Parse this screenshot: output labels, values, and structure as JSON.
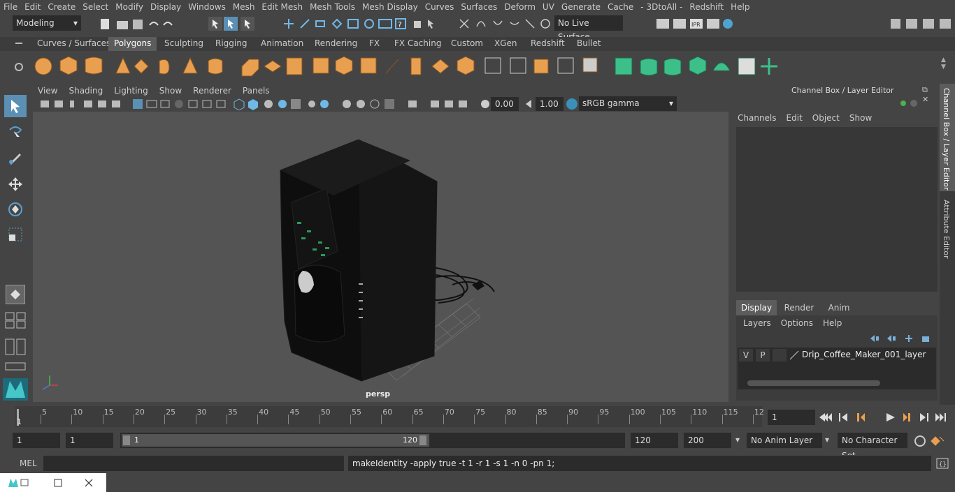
{
  "menu": [
    "File",
    "Edit",
    "Create",
    "Select",
    "Modify",
    "Display",
    "Windows",
    "Mesh",
    "Edit Mesh",
    "Mesh Tools",
    "Mesh Display",
    "Curves",
    "Surfaces",
    "Deform",
    "UV",
    "Generate",
    "Cache",
    "- 3DtoAll -",
    "Redshift",
    "Help"
  ],
  "status": {
    "workspace": "Modeling",
    "live_surface": "No Live Surface"
  },
  "shelf_tabs": [
    "Curves / Surfaces",
    "Polygons",
    "Sculpting",
    "Rigging",
    "Animation",
    "Rendering",
    "FX",
    "FX Caching",
    "Custom",
    "XGen",
    "Redshift",
    "Bullet"
  ],
  "shelf_active": "Polygons",
  "panel_menu": [
    "View",
    "Shading",
    "Lighting",
    "Show",
    "Renderer",
    "Panels"
  ],
  "panel_toolbar": {
    "exposure": "0.00",
    "gamma": "1.00",
    "color_space": "sRGB gamma"
  },
  "viewport": {
    "camera_label": "persp"
  },
  "channel_box": {
    "title": "Channel Box / Layer Editor",
    "menu": [
      "Channels",
      "Edit",
      "Object",
      "Show"
    ],
    "tabs": [
      "Display",
      "Render",
      "Anim"
    ],
    "active_tab": "Display",
    "layer_menu": [
      "Layers",
      "Options",
      "Help"
    ],
    "layer": {
      "v": "V",
      "p": "P",
      "name": "Drip_Coffee_Maker_001_layer"
    }
  },
  "side_tabs": {
    "channel": "Channel Box / Layer Editor",
    "attribute": "Attribute Editor"
  },
  "timeline": {
    "ticks": [
      "5",
      "10",
      "15",
      "20",
      "25",
      "30",
      "35",
      "40",
      "45",
      "50",
      "55",
      "60",
      "65",
      "70",
      "75",
      "80",
      "85",
      "90",
      "95",
      "100",
      "105",
      "110",
      "115",
      "12"
    ],
    "start_marker": "1",
    "current_frame": "1"
  },
  "range": {
    "start": "1",
    "anim_start": "1",
    "slider_start": "1",
    "slider_end": "120",
    "end": "120",
    "anim_end": "200",
    "anim_layer": "No Anim Layer",
    "char_set": "No Character Set"
  },
  "command": {
    "label": "MEL",
    "output": "makeIdentity -apply true -t 1 -r 1 -s 1 -n 0 -pn 1;"
  }
}
